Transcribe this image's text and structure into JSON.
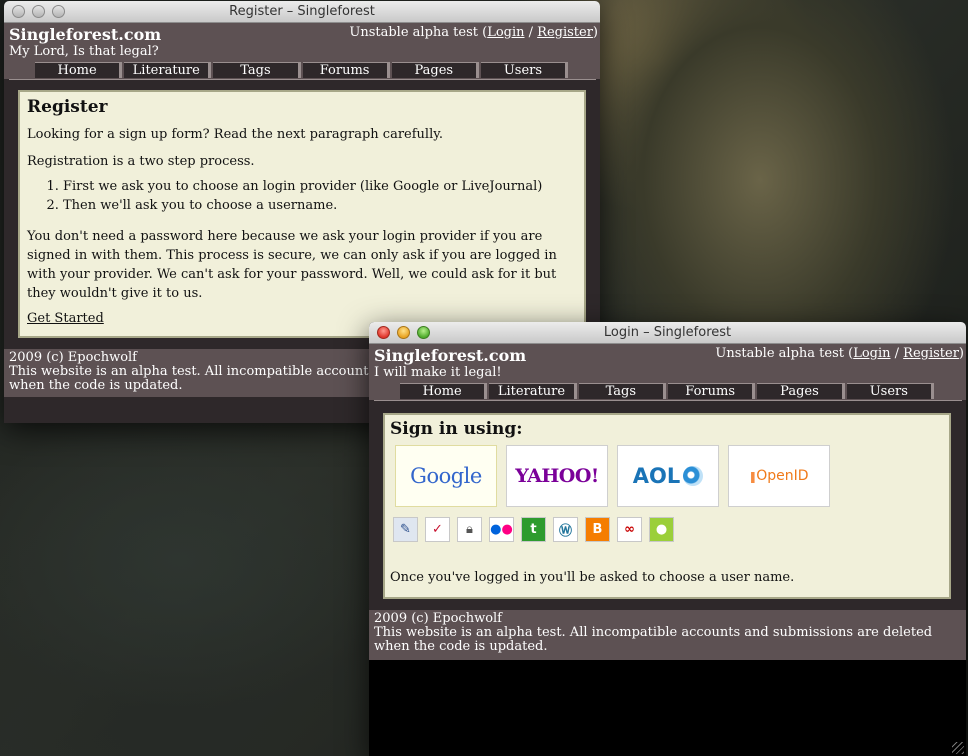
{
  "register_window": {
    "title": "Register – Singleforest",
    "site_title": "Singleforest.com",
    "tagline": "My Lord, Is that legal?",
    "top_right": {
      "prefix": "Unstable alpha test (",
      "login": "Login",
      "sep": " / ",
      "register": "Register",
      "suffix": ")"
    },
    "tabs": [
      "Home",
      "Literature",
      "Tags",
      "Forums",
      "Pages",
      "Users"
    ],
    "heading": "Register",
    "para1": "Looking for a sign up form? Read the next paragraph carefully.",
    "para2": "Registration is a two step process.",
    "steps": [
      "First we ask you to choose an login provider (like Google or LiveJournal)",
      "Then we'll ask you to choose a username."
    ],
    "para3": "You don't need a password here because we ask your login provider if you are signed in with them. This process is secure, we can only ask if you are logged in with your provider. We can't ask for your password. Well, we could ask for it but they wouldn't give it to us.",
    "get_started": "Get Started",
    "footer_line1": "2009 (c) Epochwolf",
    "footer_line2": "This website is an alpha test. All incompatible accounts and submissions are deleted when the code is updated."
  },
  "login_window": {
    "title": "Login – Singleforest",
    "site_title": "Singleforest.com",
    "tagline": "I will make it legal!",
    "top_right": {
      "prefix": "Unstable alpha test (",
      "login": "Login",
      "sep": " / ",
      "register": "Register",
      "suffix": ")"
    },
    "tabs": [
      "Home",
      "Literature",
      "Tags",
      "Forums",
      "Pages",
      "Users"
    ],
    "heading": "Sign in using:",
    "providers": [
      "Google",
      "YAHOO!",
      "AOL",
      "OpenID"
    ],
    "small_providers": [
      "myopenid-icon",
      "verisign-icon",
      "lock-icon",
      "flickr-icon",
      "technorati-icon",
      "wordpress-icon",
      "blogger-icon",
      "livejournal-icon",
      "claimid-icon"
    ],
    "note": "Once you've logged in you'll be asked to choose a user name.",
    "footer_line1": "2009 (c) Epochwolf",
    "footer_line2": "This website is an alpha test. All incompatible accounts and submissions are deleted when the code is updated."
  },
  "colors": {
    "header": "#5d5153",
    "content_bg": "#f1f0da",
    "frame": "#2e282a"
  }
}
